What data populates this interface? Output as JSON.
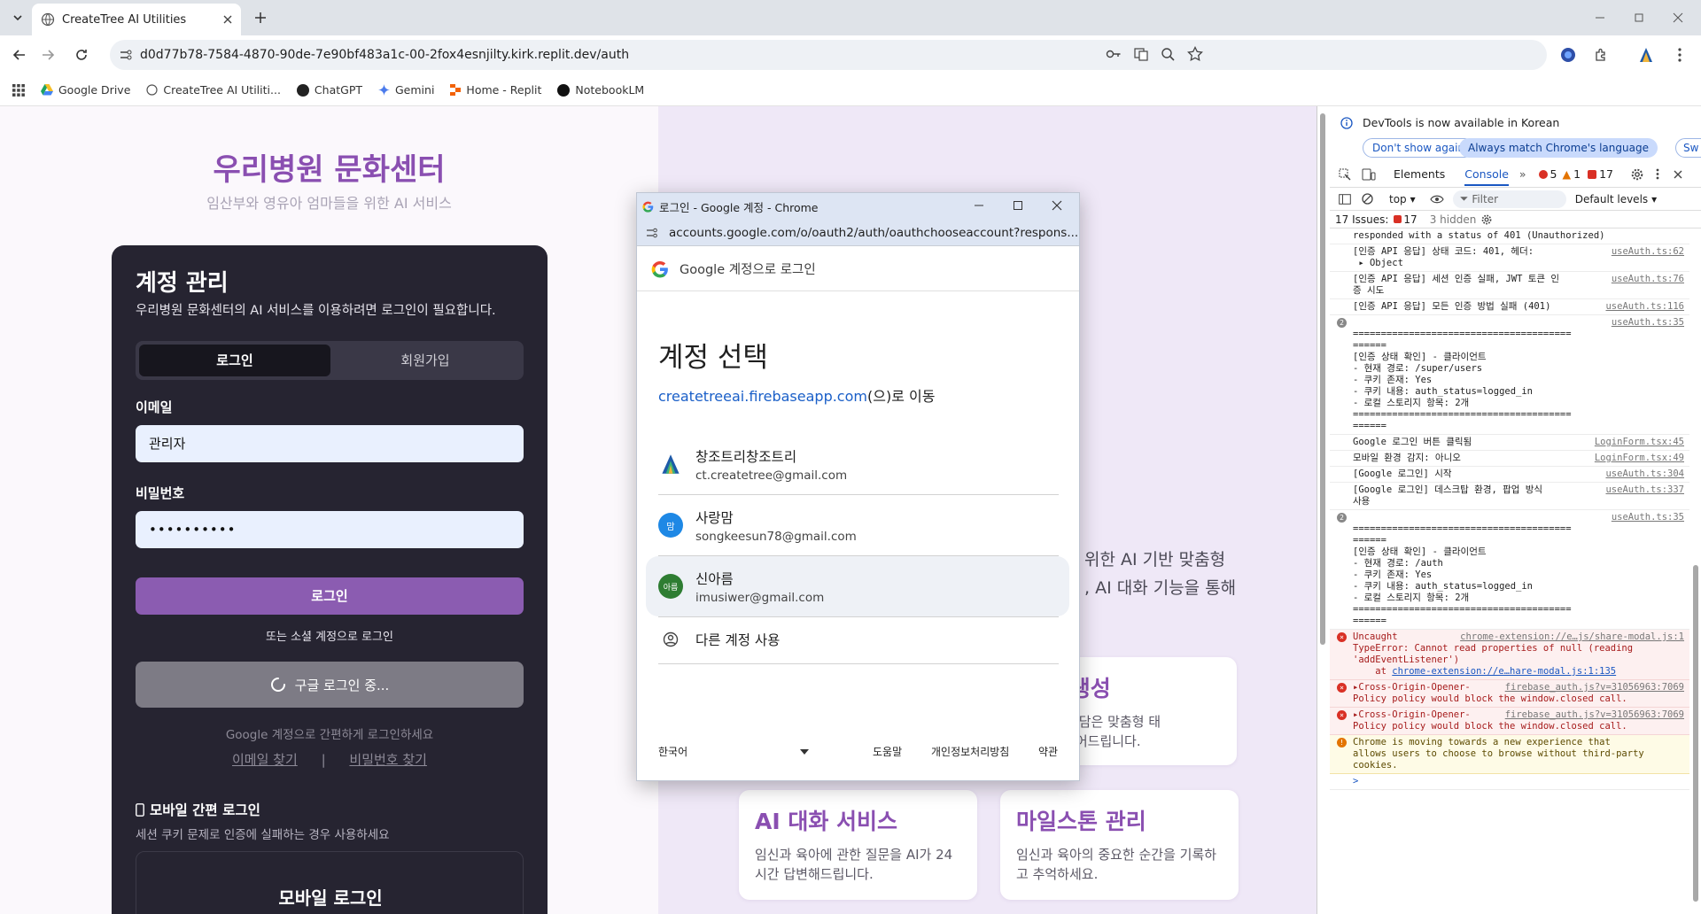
{
  "browser": {
    "tab_title": "CreateTree AI Utilities",
    "url": "d0d77b78-7584-4870-90de-7e90bf483a1c-00-2fox4esnjilty.kirk.replit.dev/auth",
    "bookmarks": [
      "Google Drive",
      "CreateTree AI Utiliti...",
      "ChatGPT",
      "Gemini",
      "Home - Replit",
      "NotebookLM"
    ]
  },
  "page": {
    "hospital_title": "우리병원 문화센터",
    "hospital_subtitle": "임산부와 영유아 엄마들을 위한 AI 서비스",
    "card": {
      "title": "계정 관리",
      "description": "우리병원 문화센터의 AI 서비스를 이용하려면 로그인이 필요합니다.",
      "tab_login": "로그인",
      "tab_signup": "회원가입",
      "email_label": "이메일",
      "email_value": "관리자",
      "password_label": "비밀번호",
      "password_value": "••••••••••",
      "login_button": "로그인",
      "or_social": "또는 소셜 계정으로 로그인",
      "google_button": "구글 로그인 중...",
      "google_desc": "Google 계정으로 간편하게 로그인하세요",
      "find_email": "이메일 찾기",
      "divider": "|",
      "find_password": "비밀번호 찾기",
      "mobile_title": "모바일 간편 로그인",
      "mobile_desc": "세션 쿠키 문제로 인증에 실패하는 경우 사용하세요",
      "mobile_box_title": "모바일 로그인"
    },
    "hero_text_line1": "위한 AI 기반 맞춤형",
    "hero_text_line2": ", AI 대화 기능을 통해",
    "features": [
      {
        "title": "작곡 생성",
        "desc": "과 성격을 담은 맞춤형 태\nAI가 만들어드립니다."
      },
      {
        "title": "AI 대화 서비스",
        "desc": "임신과 육아에 관한 질문을 AI가 24\n시간 답변해드립니다."
      },
      {
        "title": "마일스톤 관리",
        "desc": "임신과 육아의 중요한 순간을 기록하\n고 추억하세요."
      }
    ]
  },
  "popup": {
    "window_title": "로그인 - Google 계정 - Chrome",
    "url": "accounts.google.com/o/oauth2/auth/oauthchooseaccount?respons...",
    "header": "Google 계정으로 로그인",
    "heading": "계정 선택",
    "destination_domain": "createtreeai.firebaseapp.com",
    "destination_suffix": "(으)로 이동",
    "accounts": [
      {
        "name": "창조트리창조트리",
        "email": "ct.createtree@gmail.com",
        "avatar_color": "#ffffff",
        "avatar_text": ""
      },
      {
        "name": "사랑맘",
        "email": "songkeesun78@gmail.com",
        "avatar_color": "#1e88e5",
        "avatar_text": "맘"
      },
      {
        "name": "신아름",
        "email": "imusiwer@gmail.com",
        "avatar_color": "#2e7d32",
        "avatar_text": "아름"
      }
    ],
    "other_account": "다른 계정 사용",
    "language": "한국어",
    "footer_help": "도움말",
    "footer_privacy": "개인정보처리방침",
    "footer_terms": "약관"
  },
  "devtools": {
    "banner": "DevTools is now available in Korean",
    "dont_show": "Don't show again",
    "always_match": "Always match Chrome's language",
    "switch_short": "Sw",
    "tab_elements": "Elements",
    "tab_console": "Console",
    "error_count": "5",
    "warning_count": "1",
    "issue_count": "17",
    "context": "top",
    "filter_placeholder": "Filter",
    "levels": "Default levels",
    "issues_text": "17 Issues:",
    "issues_count": "17",
    "hidden": "3 hidden",
    "lines": [
      {
        "kind": "log",
        "text": "responded with a status of 401 (Unauthorized)",
        "src": ""
      },
      {
        "kind": "log",
        "text": "[인증 API 응답] 상태 코드: 401, 헤더:\n ▸ Object",
        "src": "useAuth.ts:62"
      },
      {
        "kind": "log",
        "text": "[인증 API 응답] 세션 인증 실패, JWT 토큰 인\n증 시도",
        "src": "useAuth.ts:76"
      },
      {
        "kind": "log",
        "text": "[인증 API 응답] 모든 인증 방법 실패 (401)",
        "src": "useAuth.ts:116"
      },
      {
        "kind": "group",
        "text": "\n=======================================\n======\n[인증 상태 확인] - 클라이언트\n- 현재 경로: /super/users\n- 쿠키 존재: Yes\n- 쿠키 내용: auth_status=logged_in\n- 로컬 스토리지 항목: 2개\n=======================================\n======",
        "src": "useAuth.ts:35",
        "badge": "2"
      },
      {
        "kind": "log",
        "text": "Google 로그인 버튼 클릭됨",
        "src": "LoginForm.tsx:45"
      },
      {
        "kind": "log",
        "text": "모바일 환경 감지: 아니오",
        "src": "LoginForm.tsx:49"
      },
      {
        "kind": "log",
        "text": "[Google 로그인] 시작",
        "src": "useAuth.ts:304"
      },
      {
        "kind": "log",
        "text": "[Google 로그인] 데스크탑 환경, 팝업 방식\n사용",
        "src": "useAuth.ts:337"
      },
      {
        "kind": "group",
        "text": "\n=======================================\n======\n[인증 상태 확인] - 클라이언트\n- 현재 경로: /auth\n- 쿠키 존재: Yes\n- 쿠키 내용: auth_status=logged_in\n- 로컬 스토리지 항목: 2개\n=======================================\n======",
        "src": "useAuth.ts:35",
        "badge": "2"
      },
      {
        "kind": "err",
        "text": "Uncaught\nTypeError: Cannot read properties of null (reading\n'addEventListener')\n    at ",
        "link": "chrome-extension://e…hare-modal.js:1:135",
        "src": "chrome-extension://e…js/share-modal.js:1"
      },
      {
        "kind": "err",
        "text": "▸Cross-Origin-Opener-\nPolicy policy would block the window.closed call.",
        "src": "firebase_auth.js?v=31056963:7069"
      },
      {
        "kind": "err",
        "text": "▸Cross-Origin-Opener-\nPolicy policy would block the window.closed call.",
        "src": "firebase_auth.js?v=31056963:7069"
      },
      {
        "kind": "warn",
        "text": "Chrome is moving towards a new experience that\nallows users to choose to browse without third-party\ncookies.",
        "src": ""
      }
    ],
    "prompt": ">"
  }
}
